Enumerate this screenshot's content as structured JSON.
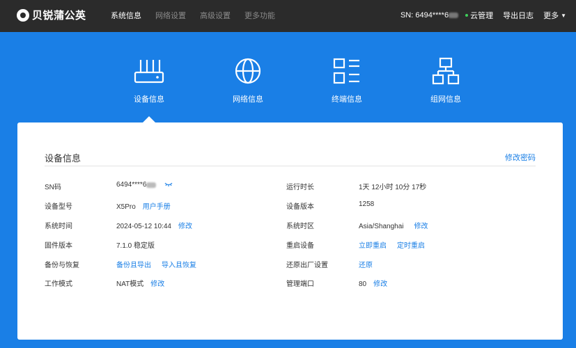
{
  "brand": {
    "name": "贝锐蒲公英"
  },
  "nav": [
    {
      "label": "系统信息",
      "active": true
    },
    {
      "label": "网络设置",
      "active": false
    },
    {
      "label": "高级设置",
      "active": false
    },
    {
      "label": "更多功能",
      "active": false
    }
  ],
  "topright": {
    "sn": "SN: 6494****6",
    "cloud": "云管理",
    "export": "导出日志",
    "more": "更多"
  },
  "tabs": [
    {
      "label": "设备信息",
      "icon": "router-icon"
    },
    {
      "label": "网络信息",
      "icon": "globe-icon"
    },
    {
      "label": "终端信息",
      "icon": "list-icon"
    },
    {
      "label": "组网信息",
      "icon": "network-icon"
    }
  ],
  "card": {
    "title": "设备信息",
    "action": "修改密码",
    "left": [
      {
        "label": "SN码",
        "value": "6494****6"
      },
      {
        "label": "设备型号",
        "value": "X5Pro",
        "links": [
          "用户手册"
        ]
      },
      {
        "label": "系统时间",
        "value": "2024-05-12 10:44",
        "links": [
          "修改"
        ]
      },
      {
        "label": "固件版本",
        "value": "7.1.0 稳定版"
      },
      {
        "label": "备份与恢复",
        "value": "",
        "links": [
          "备份且导出",
          "导入且恢复"
        ]
      },
      {
        "label": "工作模式",
        "value": "NAT模式",
        "links": [
          "修改"
        ]
      }
    ],
    "right": [
      {
        "label": "运行时长",
        "value": "1天 12小时 10分 17秒"
      },
      {
        "label": "设备版本",
        "value": "1258"
      },
      {
        "label": "系统时区",
        "value": "Asia/Shanghai",
        "links": [
          "修改"
        ]
      },
      {
        "label": "重启设备",
        "value": "",
        "links": [
          "立即重启",
          "定时重启"
        ]
      },
      {
        "label": "还原出厂设置",
        "value": "",
        "links": [
          "还原"
        ]
      },
      {
        "label": "管理端口",
        "value": "80",
        "links": [
          "修改"
        ]
      }
    ]
  },
  "colors": {
    "accent": "#1a7fe6",
    "topbar": "#2b2b2b",
    "online": "#3ecf5a"
  }
}
